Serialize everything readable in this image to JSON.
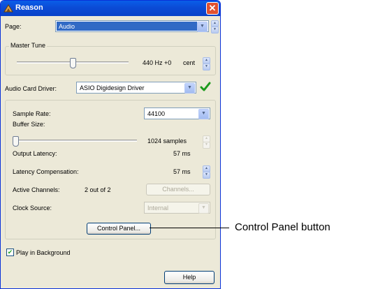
{
  "window": {
    "title": "Reason"
  },
  "page": {
    "label": "Page:",
    "value": "Audio"
  },
  "master_tune": {
    "legend": "Master Tune",
    "value_text": "440 Hz +0",
    "unit": "cent",
    "slider_fraction": 0.5
  },
  "audio_card": {
    "label": "Audio Card Driver:",
    "value": "ASIO Digidesign Driver"
  },
  "sample_rate": {
    "label": "Sample Rate:",
    "value": "44100"
  },
  "buffer_size": {
    "label": "Buffer Size:",
    "value_text": "1024 samples",
    "slider_fraction": 0.0
  },
  "output_latency": {
    "label": "Output Latency:",
    "value": "57 ms"
  },
  "latency_comp": {
    "label": "Latency Compensation:",
    "value": "57 ms"
  },
  "active_channels": {
    "label": "Active Channels:",
    "value": "2 out of 2",
    "button": "Channels..."
  },
  "clock_source": {
    "label": "Clock Source:",
    "value": "Internal"
  },
  "control_panel": {
    "button": "Control Panel..."
  },
  "play_in_background": {
    "label": "Play in Background",
    "checked": true
  },
  "help": {
    "button": "Help"
  },
  "callout": {
    "text": "Control Panel button"
  },
  "icons": {
    "close": "close-icon",
    "app": "reason-app-icon",
    "check": "green-checkmark-icon"
  }
}
